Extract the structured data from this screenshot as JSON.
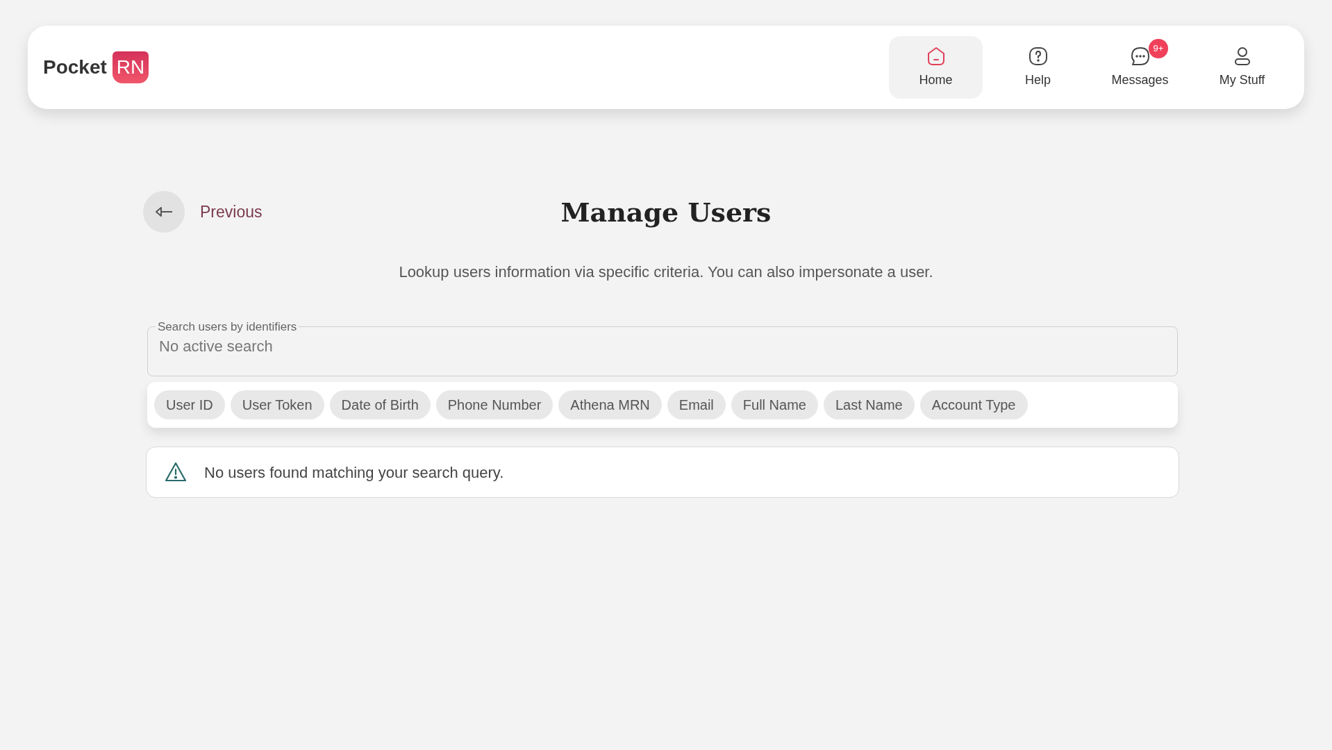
{
  "header": {
    "logo_text": "Pocket",
    "logo_badge": "RN",
    "nav": [
      {
        "kind": "home",
        "label": "Home",
        "selected": true
      },
      {
        "kind": "help",
        "label": "Help",
        "selected": false
      },
      {
        "kind": "messages",
        "label": "Messages",
        "selected": false,
        "badge": "9+"
      },
      {
        "kind": "user",
        "label": "My Stuff",
        "selected": false
      }
    ]
  },
  "back_link": "Previous",
  "title": "Manage Users",
  "subtitle": "Lookup users information via specific criteria. You can also impersonate a user.",
  "search": {
    "label": "Search users by identifiers",
    "placeholder": "No active search"
  },
  "filters": [
    "User ID",
    "User Token",
    "Date of Birth",
    "Phone Number",
    "Athena MRN",
    "Email",
    "Full Name",
    "Last Name",
    "Account Type"
  ],
  "alert": "No users found matching your search query."
}
